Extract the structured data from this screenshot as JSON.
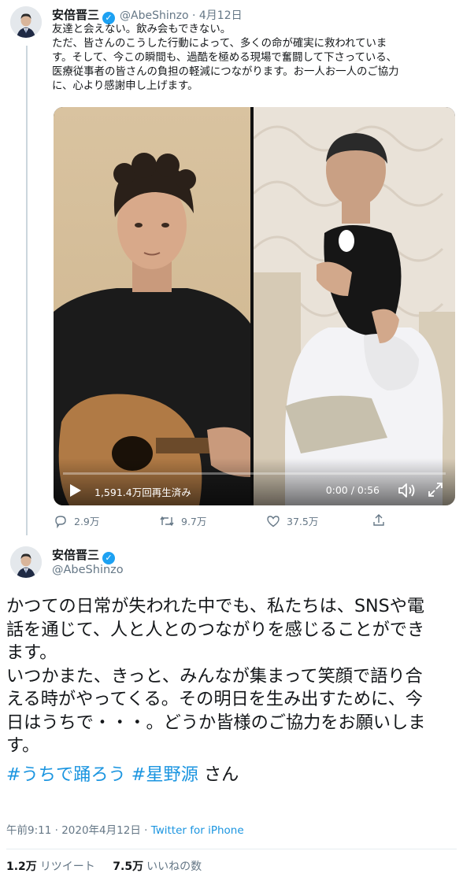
{
  "tweet1": {
    "author_name": "安倍晋三",
    "handle": "@AbeShinzo",
    "date": "4月12日",
    "lines": [
      "友達と会えない。飲み会もできない。",
      "ただ、皆さんのこうした行動によって、多くの命が確実に救われていま",
      "す。そして、今この瞬間も、過酷を極める現場で奮闘して下さっている、",
      "医療従事者の皆さんの負担の軽減につながります。お一人お一人のご協力",
      "に、心より感謝申し上げます。"
    ],
    "video": {
      "views": "1,591.4万回再生済み",
      "time": "0:00 / 0:56",
      "progress": 0
    },
    "actions": {
      "replies": "2.9万",
      "retweets": "9.7万",
      "likes": "37.5万"
    }
  },
  "tweet2": {
    "author_name": "安倍晋三",
    "handle": "@AbeShinzo",
    "lines": [
      "かつての日常が失われた中でも、私たちは、SNSや電",
      "話を通じて、人と人とのつながりを感じることができ",
      "ます。",
      "いつかまた、きっと、みんなが集まって笑顔で語り合",
      "える時がやってくる。その明日を生み出すために、今",
      "日はうちで・・・。どうか皆様のご協力をお願いしま",
      "す。"
    ],
    "hashtag1": "#うちで踊ろう",
    "hashtag2": "#星野源",
    "hashtag_suffix": "さん",
    "timestamp": "午前9:11 · 2020年4月12日 · ",
    "source": "Twitter for iPhone",
    "retweet_count": "1.2万",
    "retweet_label": "リツイート",
    "like_count": "7.5万",
    "like_label": "いいねの数"
  },
  "colors": {
    "link": "#1b95e0",
    "verified": "#1da1f2",
    "muted": "#657786",
    "text": "#14171a"
  },
  "icons": [
    "verified-badge-icon",
    "reply-icon",
    "retweet-icon",
    "like-icon",
    "share-icon",
    "play-icon",
    "volume-icon",
    "fullscreen-icon"
  ]
}
